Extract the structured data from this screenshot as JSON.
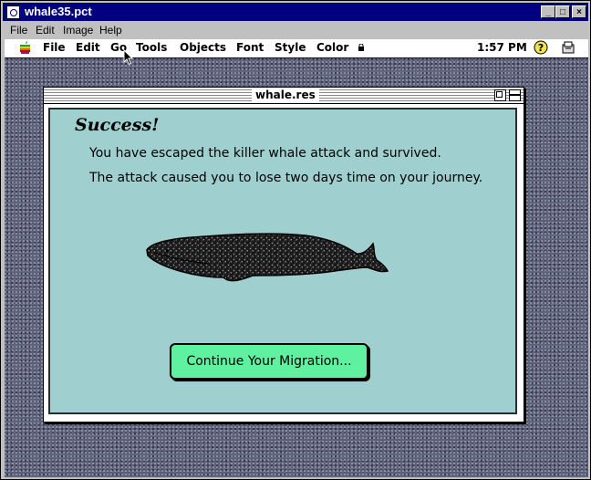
{
  "window": {
    "title": "whale35.pct",
    "menu": [
      "File",
      "Edit",
      "Image",
      "Help"
    ],
    "minimize_label": "_",
    "maximize_label": "□",
    "close_label": "×"
  },
  "mac_menubar": {
    "items": [
      "File",
      "Edit",
      "Go",
      "Tools",
      "Objects",
      "Font",
      "Style",
      "Color"
    ],
    "clock": "1:57 PM",
    "help_label": "?"
  },
  "document": {
    "title": "whale.res",
    "heading": "Success!",
    "line1": "You have escaped the killer whale attack and survived.",
    "line2": "The attack caused you to lose two days time on your journey.",
    "button_label": "Continue Your Migration..."
  },
  "colors": {
    "titlebar": "#000080",
    "content_bg": "#9fcfcf",
    "button_bg": "#5ff0a0",
    "desktop": "#5a5e77"
  }
}
